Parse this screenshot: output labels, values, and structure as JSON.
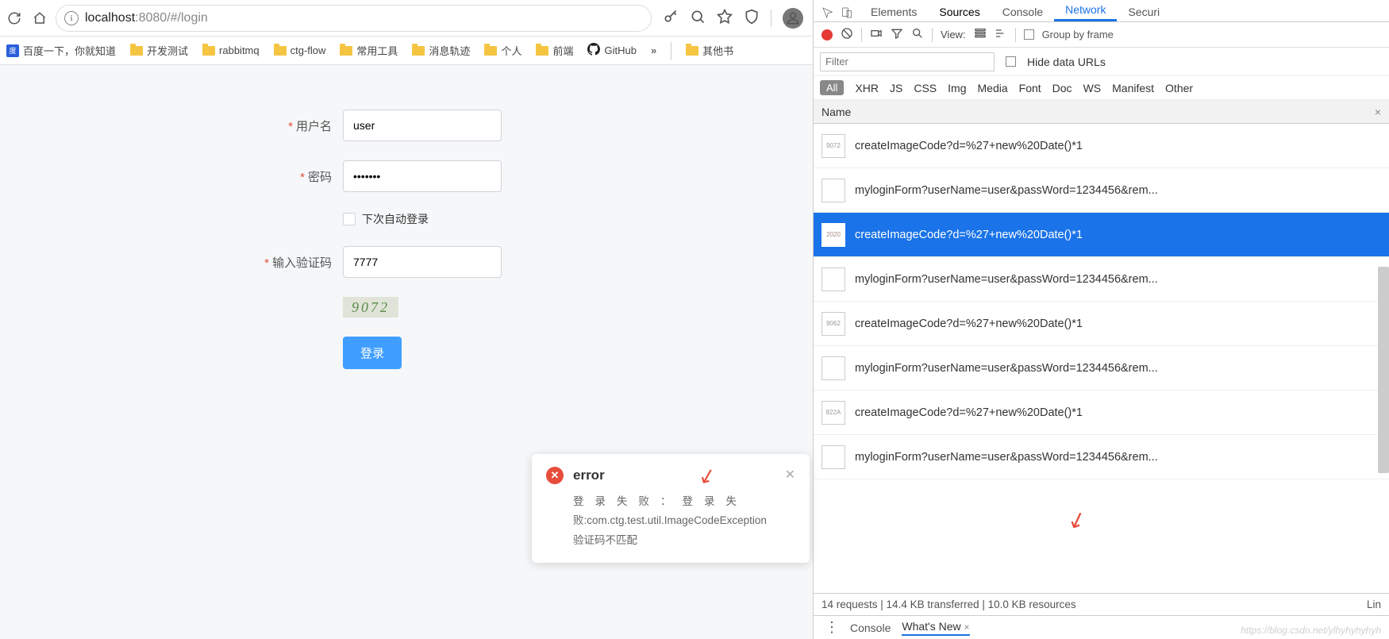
{
  "browser": {
    "url_host": "localhost",
    "url_rest": ":8080/#/login"
  },
  "bookmarks": {
    "baidu": "百度一下，你就知道",
    "dev": "开发测试",
    "rabbit": "rabbitmq",
    "ctg": "ctg-flow",
    "tools": "常用工具",
    "msg": "消息轨迹",
    "personal": "个人",
    "frontend": "前端",
    "github": "GitHub",
    "more": "»",
    "other": "其他书"
  },
  "form": {
    "username_label": "用户名",
    "username_value": "user",
    "password_label": "密码",
    "password_value": "•••••••",
    "auto_login": "下次自动登录",
    "captcha_label": "输入验证码",
    "captcha_value": "7777",
    "captcha_image": "9072",
    "submit": "登录"
  },
  "toast": {
    "title": "error",
    "body_line1": "登录失败：登录失",
    "body_line2": "败:com.ctg.test.util.ImageCodeException",
    "body_line3": "验证码不匹配"
  },
  "devtools": {
    "tabs": {
      "elements": "Elements",
      "sources": "Sources",
      "console": "Console",
      "network": "Network",
      "security": "Securi"
    },
    "toolbar": {
      "view": "View:",
      "group": "Group by frame"
    },
    "filter": {
      "placeholder": "Filter",
      "hide": "Hide data URLs"
    },
    "types": {
      "all": "All",
      "xhr": "XHR",
      "js": "JS",
      "css": "CSS",
      "img": "Img",
      "media": "Media",
      "font": "Font",
      "doc": "Doc",
      "ws": "WS",
      "manifest": "Manifest",
      "other": "Other"
    },
    "name_header": "Name",
    "requests": [
      {
        "text": "myloginForm?userName=user&passWord=1234456&rem...",
        "selected": false,
        "thumb": ""
      },
      {
        "text": "createImageCode?d=%27+new%20Date()*1",
        "selected": false,
        "thumb": "822A"
      },
      {
        "text": "myloginForm?userName=user&passWord=1234456&rem...",
        "selected": false,
        "thumb": ""
      },
      {
        "text": "createImageCode?d=%27+new%20Date()*1",
        "selected": false,
        "thumb": "9062"
      },
      {
        "text": "myloginForm?userName=user&passWord=1234456&rem...",
        "selected": false,
        "thumb": ""
      },
      {
        "text": "createImageCode?d=%27+new%20Date()*1",
        "selected": true,
        "thumb": "2020"
      },
      {
        "text": "myloginForm?userName=user&passWord=1234456&rem...",
        "selected": false,
        "thumb": ""
      },
      {
        "text": "createImageCode?d=%27+new%20Date()*1",
        "selected": false,
        "thumb": "9072"
      }
    ],
    "status": {
      "left": "14 requests  |  14.4 KB transferred  |  10.0 KB resources",
      "right": "Lin"
    },
    "drawer": {
      "console": "Console",
      "whats": "What's New"
    }
  },
  "watermark": "https://blog.csdn.net/ylhyhyhyhyh"
}
